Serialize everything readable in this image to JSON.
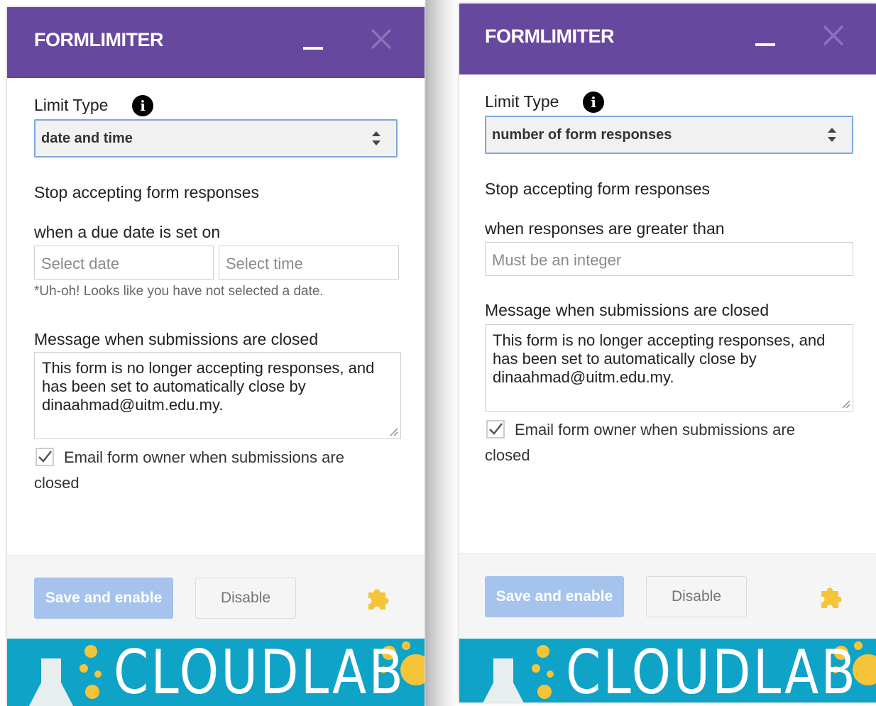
{
  "panels": [
    {
      "title": "FORMLIMITER",
      "limit_type_label": "Limit Type",
      "limit_type_value": "date and time",
      "stop_label": "Stop accepting form responses",
      "condition_label": "when a due date is set on",
      "date_placeholder": "Select date",
      "time_placeholder": "Select time",
      "error_hint": "*Uh-oh! Looks like you have not selected a date.",
      "message_label": "Message when submissions are closed",
      "message_text": "This form is no longer accepting responses, and has been set to automatically close by dinaahmad@uitm.edu.my.",
      "email_owner_label": "Email form owner when submissions are closed",
      "email_owner_checked": true,
      "save_label": "Save and enable",
      "disable_label": "Disable",
      "banner_text": "CLOUDLAB"
    },
    {
      "title": "FORMLIMITER",
      "limit_type_label": "Limit Type",
      "limit_type_value": "number of form responses",
      "stop_label": "Stop accepting form responses",
      "condition_label": "when responses are greater than",
      "integer_placeholder": "Must be an integer",
      "message_label": "Message when submissions are closed",
      "message_text": "This form is no longer accepting responses, and has been set to automatically close by dinaahmad@uitm.edu.my.",
      "email_owner_label": "Email form owner when submissions are closed",
      "email_owner_checked": true,
      "save_label": "Save and enable",
      "disable_label": "Disable",
      "banner_text": "CLOUDLAB"
    }
  ],
  "colors": {
    "header": "#67489f",
    "primary_button": "#a5c3ec",
    "banner": "#0fa3c8",
    "bubbles": "#f6c439",
    "puzzle": "#f6c439"
  },
  "icons": [
    "info-icon",
    "close-icon",
    "minimize-icon",
    "select-arrows-icon",
    "checkbox-icon",
    "puzzle-icon",
    "flask-icon"
  ]
}
